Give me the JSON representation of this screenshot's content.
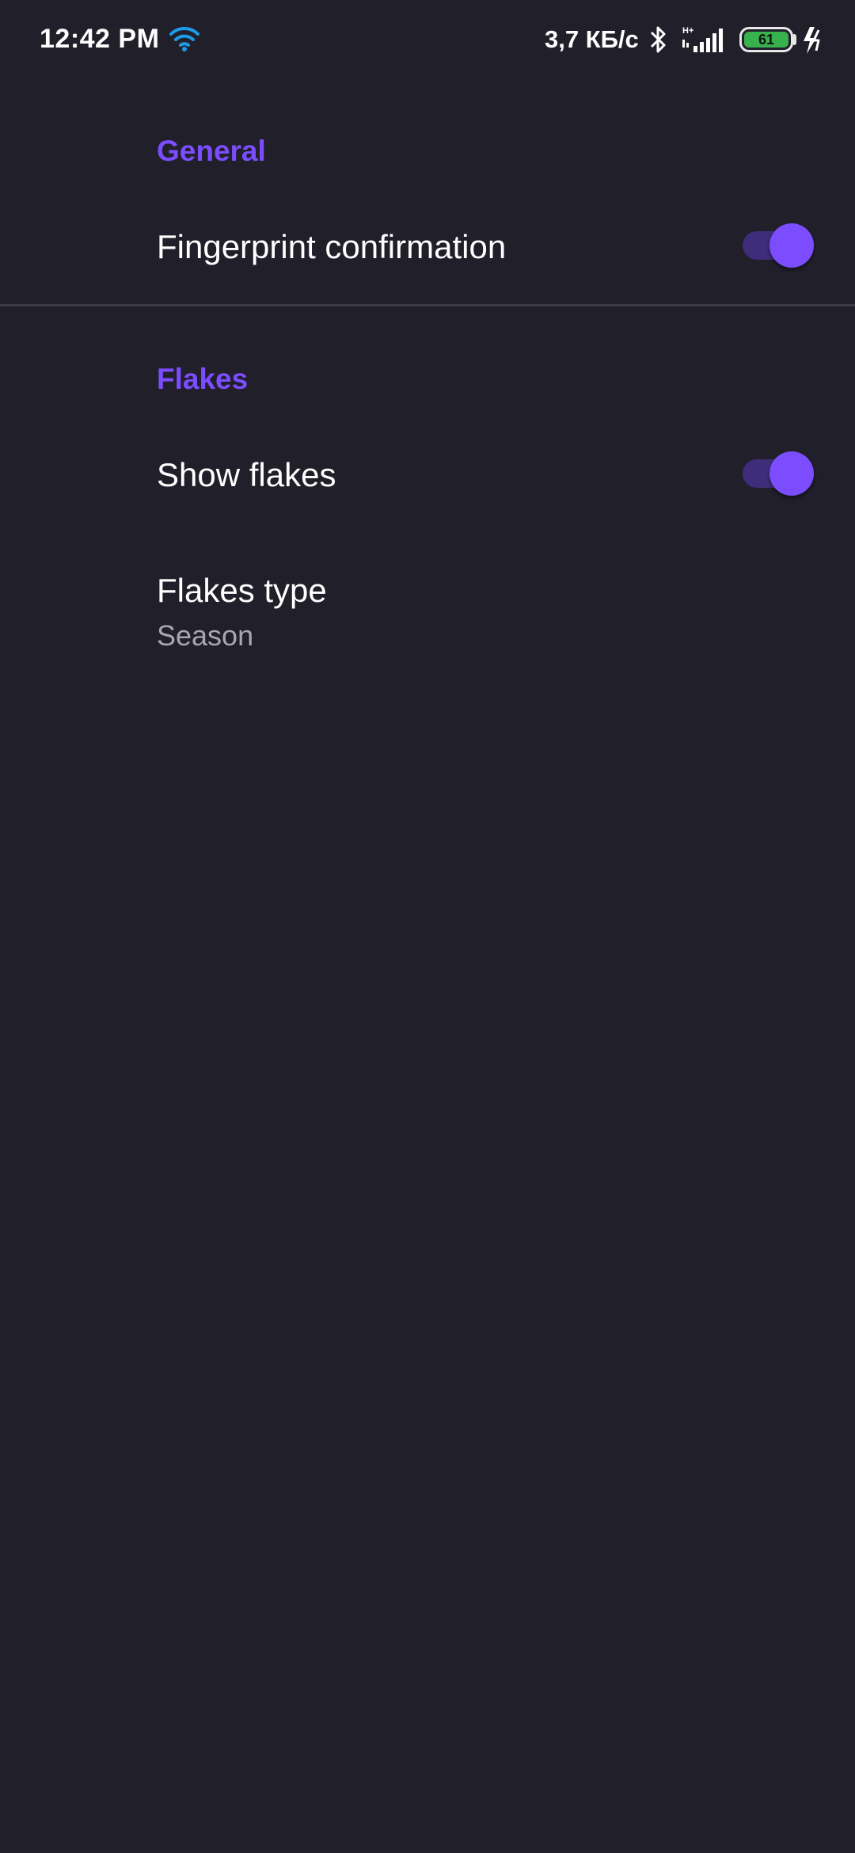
{
  "status_bar": {
    "time": "12:42 PM",
    "network_speed": "3,7 КБ/с",
    "battery_level": "61",
    "icons": [
      "wifi-icon",
      "bluetooth-icon",
      "signal-icon",
      "battery-icon",
      "charging-icon"
    ],
    "colors": {
      "wifi": "#1e9be8",
      "battery": "#37b24d"
    }
  },
  "sections": {
    "general": {
      "header": "General",
      "fingerprint": {
        "title": "Fingerprint confirmation",
        "enabled": true
      }
    },
    "flakes": {
      "header": "Flakes",
      "show_flakes": {
        "title": "Show flakes",
        "enabled": true
      },
      "flakes_type": {
        "title": "Flakes type",
        "summary": "Season"
      }
    }
  },
  "colors": {
    "background": "#201f2a",
    "accent": "#7c4dff",
    "switch_track": "#3e2d79",
    "summary_text": "#a8a6b3"
  }
}
